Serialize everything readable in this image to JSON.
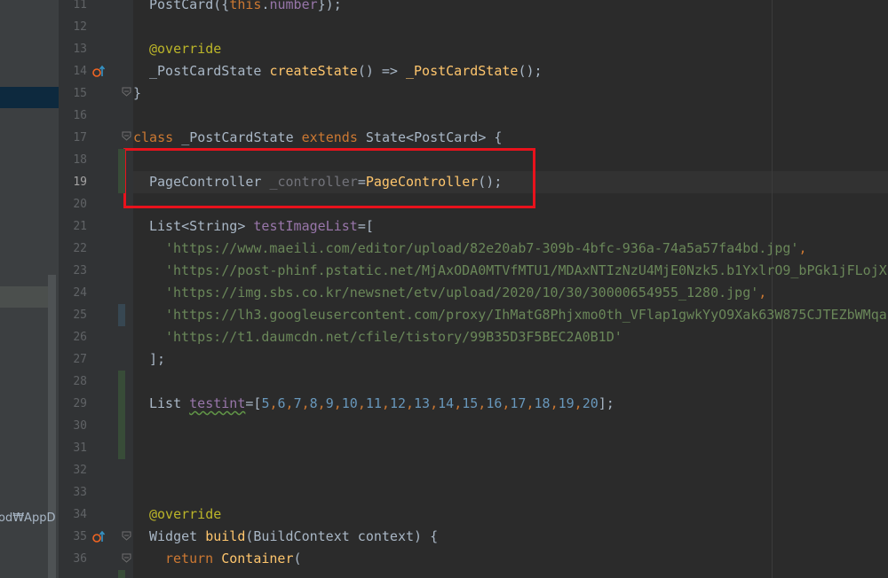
{
  "sidebar": {
    "path_fragment": "od₩AppD"
  },
  "editor": {
    "current_line": "19",
    "lines": [
      {
        "n": "11",
        "t": [
          [
            "PostCard({",
            ""
          ],
          [
            "this",
            "kw"
          ],
          [
            ".",
            ""
          ],
          [
            "number",
            "fld"
          ],
          [
            "});",
            ""
          ]
        ]
      },
      {
        "n": "12",
        "t": []
      },
      {
        "n": "13",
        "t": [
          [
            "@override",
            "ann"
          ]
        ]
      },
      {
        "n": "14",
        "t": [
          [
            "_PostCardState ",
            ""
          ],
          [
            "createState",
            "fn"
          ],
          [
            "() => ",
            ""
          ],
          [
            "_PostCardState",
            "fn"
          ],
          [
            "();",
            ""
          ]
        ]
      },
      {
        "n": "15",
        "t": [
          [
            "}",
            ""
          ]
        ]
      },
      {
        "n": "16",
        "t": []
      },
      {
        "n": "17",
        "t": [
          [
            "class ",
            "kw"
          ],
          [
            "_PostCardState ",
            ""
          ],
          [
            "extends ",
            "kw"
          ],
          [
            "State<PostCard> {",
            ""
          ]
        ]
      },
      {
        "n": "18",
        "t": []
      },
      {
        "n": "19",
        "t": [
          [
            "PageController ",
            ""
          ],
          [
            "_controller",
            "unused"
          ],
          [
            "=",
            ""
          ],
          [
            "PageController",
            "fn"
          ],
          [
            "();",
            ""
          ]
        ]
      },
      {
        "n": "20",
        "t": []
      },
      {
        "n": "21",
        "t": [
          [
            "List<String> ",
            ""
          ],
          [
            "testImageList",
            "fld"
          ],
          [
            "=[",
            ""
          ]
        ]
      },
      {
        "n": "22",
        "t": [
          [
            "'https://www.maeili.com/editor/upload/82e20ab7-309b-4bfc-936a-74a5a57fa4bd.jpg'",
            "str"
          ],
          [
            ",",
            "kw"
          ]
        ]
      },
      {
        "n": "23",
        "t": [
          [
            "'https://post-phinf.pstatic.net/MjAxODA0MTVfMTU1/MDAxNTIzNzU4MjE0Nzk5.b1YxlrO9_bPGk1jFLojX",
            "str"
          ]
        ]
      },
      {
        "n": "24",
        "t": [
          [
            "'https://img.sbs.co.kr/newsnet/etv/upload/2020/10/30/30000654955_1280.jpg'",
            "str"
          ],
          [
            ",",
            "kw"
          ]
        ]
      },
      {
        "n": "25",
        "t": [
          [
            "'https://lh3.googleusercontent.com/proxy/IhMatG8Phjxmo0th_VFlap1gwkYyO9Xak63W875CJTEZbWMqaE",
            "str"
          ]
        ]
      },
      {
        "n": "26",
        "t": [
          [
            "'https://t1.daumcdn.net/cfile/tistory/99B35D3F5BEC2A0B1D'",
            "str"
          ]
        ]
      },
      {
        "n": "27",
        "t": [
          [
            "];",
            ""
          ]
        ]
      },
      {
        "n": "28",
        "t": []
      },
      {
        "n": "29",
        "t": [
          [
            "List ",
            ""
          ],
          [
            "testint",
            "fld typo"
          ],
          [
            "=[",
            ""
          ],
          [
            "5",
            "num"
          ],
          [
            ",",
            "kw"
          ],
          [
            "6",
            "num"
          ],
          [
            ",",
            "kw"
          ],
          [
            "7",
            "num"
          ],
          [
            ",",
            "kw"
          ],
          [
            "8",
            "num"
          ],
          [
            ",",
            "kw"
          ],
          [
            "9",
            "num"
          ],
          [
            ",",
            "kw"
          ],
          [
            "10",
            "num"
          ],
          [
            ",",
            "kw"
          ],
          [
            "11",
            "num"
          ],
          [
            ",",
            "kw"
          ],
          [
            "12",
            "num"
          ],
          [
            ",",
            "kw"
          ],
          [
            "13",
            "num"
          ],
          [
            ",",
            "kw"
          ],
          [
            "14",
            "num"
          ],
          [
            ",",
            "kw"
          ],
          [
            "15",
            "num"
          ],
          [
            ",",
            "kw"
          ],
          [
            "16",
            "num"
          ],
          [
            ",",
            "kw"
          ],
          [
            "17",
            "num"
          ],
          [
            ",",
            "kw"
          ],
          [
            "18",
            "num"
          ],
          [
            ",",
            "kw"
          ],
          [
            "19",
            "num"
          ],
          [
            ",",
            "kw"
          ],
          [
            "20",
            "num"
          ],
          [
            "];",
            ""
          ]
        ]
      },
      {
        "n": "30",
        "t": []
      },
      {
        "n": "31",
        "t": []
      },
      {
        "n": "32",
        "t": []
      },
      {
        "n": "33",
        "t": []
      },
      {
        "n": "34",
        "t": [
          [
            "@override",
            "ann"
          ]
        ]
      },
      {
        "n": "35",
        "t": [
          [
            "Widget ",
            ""
          ],
          [
            "build",
            "fn"
          ],
          [
            "(BuildContext context) {",
            ""
          ]
        ]
      },
      {
        "n": "36",
        "t": [
          [
            "return ",
            "kw"
          ],
          [
            "Container",
            "fn"
          ],
          [
            "(",
            ""
          ]
        ]
      }
    ]
  },
  "colors": {
    "keyword": "#cc7832",
    "function": "#ffc66d",
    "string": "#6a8759",
    "number": "#6897bb",
    "annotation": "#bbb529",
    "field": "#9876aa",
    "highlight_box": "#e8121c"
  },
  "icons": {
    "override": "override-up-arrow-icon",
    "fold": "fold-icon"
  }
}
